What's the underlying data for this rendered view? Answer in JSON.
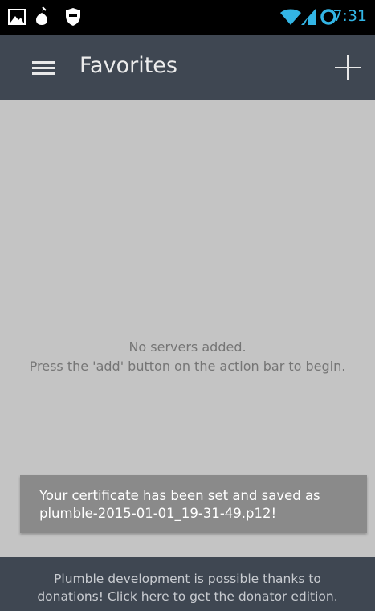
{
  "status_bar": {
    "time": "7:31",
    "left_icons": [
      "image-icon",
      "flame-icon",
      "shield-icon"
    ],
    "right_icons": [
      "wifi-icon",
      "signal-icon",
      "sync-ring-icon"
    ],
    "accent_color": "#33b5e5"
  },
  "action_bar": {
    "title": "Favorites",
    "menu_icon": "hamburger-menu-icon",
    "add_icon": "plus-icon",
    "background": "#3f4752"
  },
  "empty_state": {
    "line1": "No servers added.",
    "line2": "Press the 'add' button on the action bar to begin."
  },
  "toast": {
    "line1": "Your certificate has been set and saved as",
    "line2": "plumble-2015-01-01_19-31-49.p12!"
  },
  "footer": {
    "line1": "Plumble development is possible thanks to",
    "line2": "donations! Click here to get the donator edition."
  }
}
